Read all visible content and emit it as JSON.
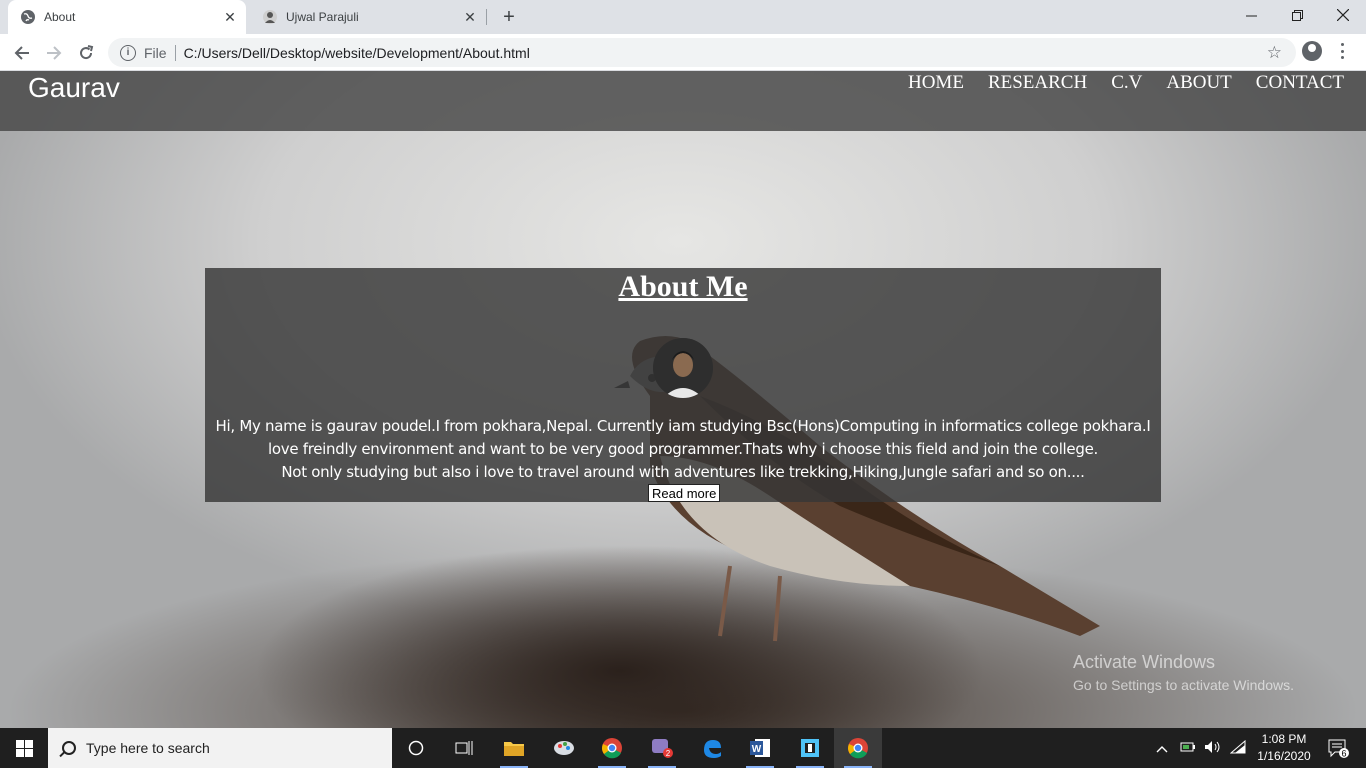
{
  "browser": {
    "tabs": [
      {
        "title": "About",
        "active": true
      },
      {
        "title": "Ujwal Parajuli",
        "active": false
      }
    ],
    "address": {
      "scheme_label": "File",
      "url": "C:/Users/Dell/Desktop/website/Development/About.html"
    }
  },
  "page": {
    "brand": "Gaurav",
    "nav": [
      "HOME",
      "RESEARCH",
      "C.V",
      "ABOUT",
      "CONTACT"
    ],
    "about": {
      "title": "About Me",
      "line1": "Hi, My name is gaurav poudel.I from pokhara,Nepal. Currently iam studying Bsc(Hons)Computing in informatics college pokhara.I",
      "line2": "love freindly environment and want to be very good programmer.Thats why i choose this field and join the college.",
      "line3": "Not only studying but also i love to travel around with adventures like trekking,Hiking,Jungle safari and so on....",
      "button": "Read more"
    },
    "watermark": {
      "line1": "Activate Windows",
      "line2": "Go to Settings to activate Windows."
    }
  },
  "taskbar": {
    "search_placeholder": "Type here to search",
    "time": "1:08 PM",
    "date": "1/16/2020",
    "notification_count": "6",
    "mail_badge": "2"
  },
  "colors": {
    "header_bg": "#464646",
    "card_bg": "#373737",
    "tabbar": "#dee1e6",
    "taskbar": "#1f1f1f"
  }
}
